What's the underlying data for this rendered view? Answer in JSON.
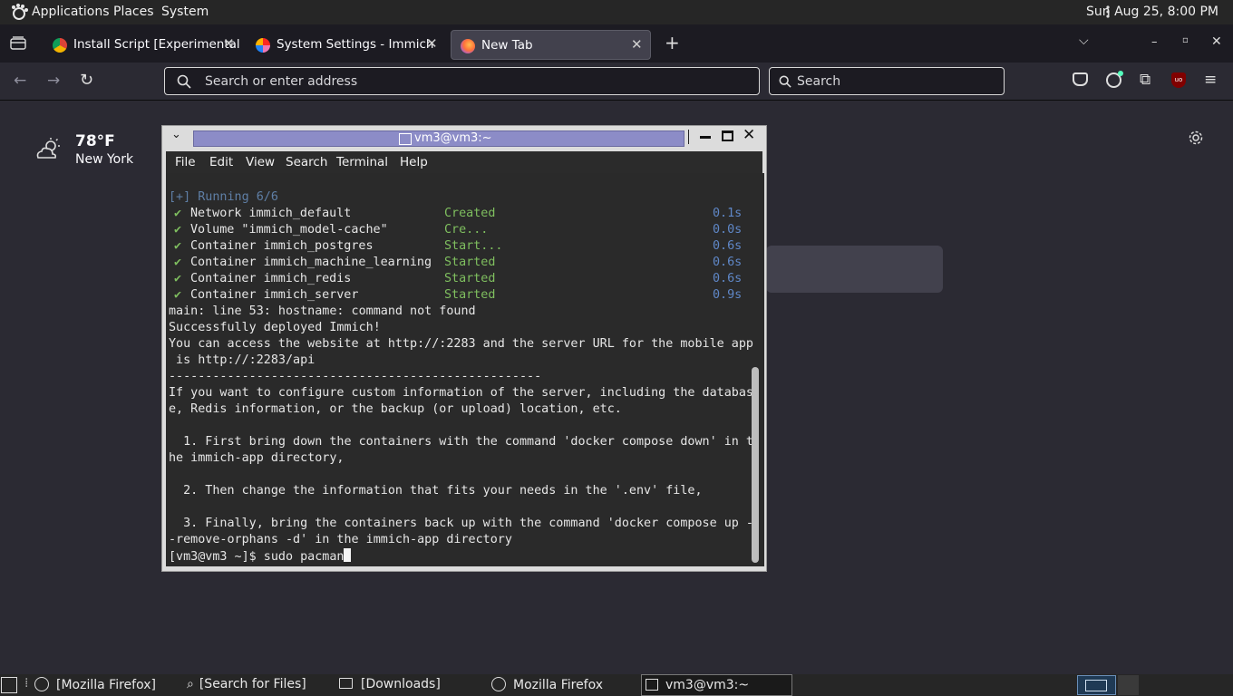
{
  "top_panel": {
    "applications": "Applications",
    "places": "Places",
    "system": "System",
    "clock": "Sun Aug 25,  8:00 PM"
  },
  "tabs": [
    {
      "label": "Install Script [Experimental]",
      "favicon": "chrome-icon"
    },
    {
      "label": "System Settings - Immich",
      "favicon": "immich-icon"
    },
    {
      "label": "New Tab",
      "favicon": "firefox-icon"
    }
  ],
  "nav": {
    "url_placeholder": "Search or enter address",
    "search_placeholder": "Search"
  },
  "weather": {
    "temp": "78°F",
    "city": "New York",
    "icon": "partly-cloudy-icon"
  },
  "terminal": {
    "title": "vm3@vm3:~",
    "menu": [
      "File",
      "Edit",
      "View",
      "Search",
      "Terminal",
      "Help"
    ],
    "running": "[+] Running 6/6",
    "items": [
      {
        "name": "Network immich_default",
        "status": "Created",
        "time": "0.1s"
      },
      {
        "name": "Volume \"immich_model-cache\"",
        "status": "Cre...",
        "time": "0.0s"
      },
      {
        "name": "Container immich_postgres",
        "status": "Start...",
        "time": "0.6s"
      },
      {
        "name": "Container immich_machine_learning",
        "status": "Started",
        "time": "0.6s"
      },
      {
        "name": "Container immich_redis",
        "status": "Started",
        "time": "0.6s"
      },
      {
        "name": "Container immich_server",
        "status": "Started",
        "time": "0.9s"
      }
    ],
    "lines": [
      "main: line 53: hostname: command not found",
      "Successfully deployed Immich!",
      "You can access the website at http://:2283 and the server URL for the mobile app",
      " is http://:2283/api",
      "---------------------------------------------------",
      "If you want to configure custom information of the server, including the databas",
      "e, Redis information, or the backup (or upload) location, etc.",
      "",
      "  1. First bring down the containers with the command 'docker compose down' in t",
      "he immich-app directory,",
      "",
      "  2. Then change the information that fits your needs in the '.env' file,",
      "",
      "  3. Finally, bring the containers back up with the command 'docker compose up -",
      "-remove-orphans -d' in the immich-app directory"
    ],
    "prompt": "[vm3@vm3 ~]$ sudo pacman"
  },
  "taskbar": {
    "items": [
      {
        "label": "[Mozilla Firefox]",
        "icon": "firefox-icon"
      },
      {
        "label": "[Search for Files]",
        "icon": "search-files-icon"
      },
      {
        "label": "[Downloads]",
        "icon": "folder-icon"
      },
      {
        "label": "Mozilla Firefox",
        "icon": "firefox-icon"
      },
      {
        "label": "vm3@vm3:~",
        "icon": "terminal-icon"
      }
    ]
  }
}
